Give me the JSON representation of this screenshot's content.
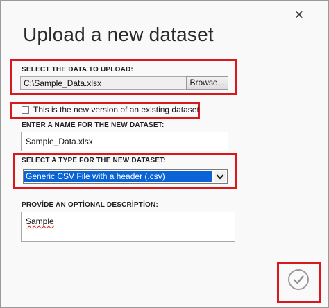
{
  "dialog": {
    "title": "Upload a new dataset",
    "close_icon": "close-icon",
    "highlight_color": "#d9181e",
    "accent_color": "#0a64d6"
  },
  "upload": {
    "label": "SELECT THE DATA TO UPLOAD:",
    "file_value": "C:\\Sample_Data.xlsx",
    "browse_label": "Browse..."
  },
  "new_version": {
    "label": "This is the new version of an existing dataset",
    "checked": false
  },
  "name": {
    "label": "ENTER A NAME FOR THE NEW DATASET:",
    "value": "Sample_Data.xlsx"
  },
  "type": {
    "label": "SELECT A TYPE FOR THE NEW DATASET:",
    "selected": "Generic CSV File with a header (.csv)",
    "arrow_icon": "chevron-down-icon"
  },
  "description": {
    "label": "PROVİDE AN OPTİONAL DESCRİPTİON:",
    "value": "Sample"
  },
  "footer": {
    "ok_icon": "checkmark-icon"
  }
}
